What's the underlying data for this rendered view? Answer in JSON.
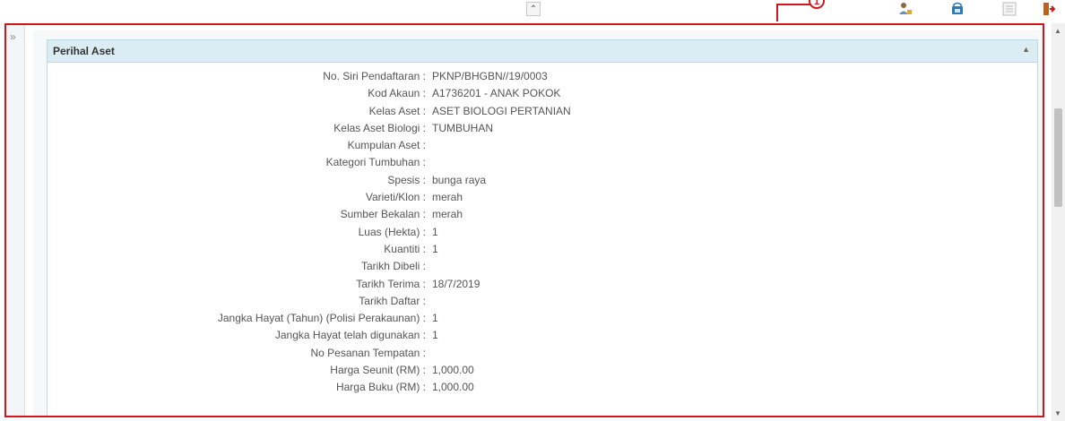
{
  "toolbar": {
    "collapse_glyph": "⌃",
    "callout_number": "1",
    "icons": [
      "user-tool-icon",
      "save-icon",
      "list-icon",
      "exit-icon"
    ]
  },
  "sidebar": {
    "expand_glyph": "»"
  },
  "panel": {
    "title": "Perihal Aset",
    "toggle_glyph": "▲"
  },
  "fields": [
    {
      "label": "No. Siri Pendaftaran :",
      "value": "PKNP/BHGBN//19/0003"
    },
    {
      "label": "Kod Akaun :",
      "value": "A1736201 - ANAK POKOK"
    },
    {
      "label": "Kelas Aset :",
      "value": "ASET BIOLOGI PERTANIAN"
    },
    {
      "label": "Kelas Aset Biologi :",
      "value": "TUMBUHAN"
    },
    {
      "label": "Kumpulan Aset :",
      "value": ""
    },
    {
      "label": "Kategori Tumbuhan :",
      "value": ""
    },
    {
      "label": "Spesis :",
      "value": "bunga raya"
    },
    {
      "label": "Varieti/Klon :",
      "value": "merah"
    },
    {
      "label": "Sumber Bekalan :",
      "value": "merah"
    },
    {
      "label": "Luas (Hekta) :",
      "value": "1"
    },
    {
      "label": "Kuantiti :",
      "value": "1"
    },
    {
      "label": "Tarikh Dibeli :",
      "value": ""
    },
    {
      "label": "Tarikh Terima :",
      "value": "18/7/2019"
    },
    {
      "label": "Tarikh Daftar :",
      "value": ""
    },
    {
      "label": "Jangka Hayat (Tahun) (Polisi Perakaunan) :",
      "value": "1"
    },
    {
      "label": "Jangka Hayat telah digunakan :",
      "value": "1"
    },
    {
      "label": "No Pesanan Tempatan :",
      "value": ""
    },
    {
      "label": "Harga Seunit (RM) :",
      "value": "1,000.00"
    },
    {
      "label": "Harga Buku (RM) :",
      "value": "1,000.00"
    }
  ],
  "colors": {
    "highlight_red": "#d0161b",
    "panel_header": "#dcecf3"
  }
}
